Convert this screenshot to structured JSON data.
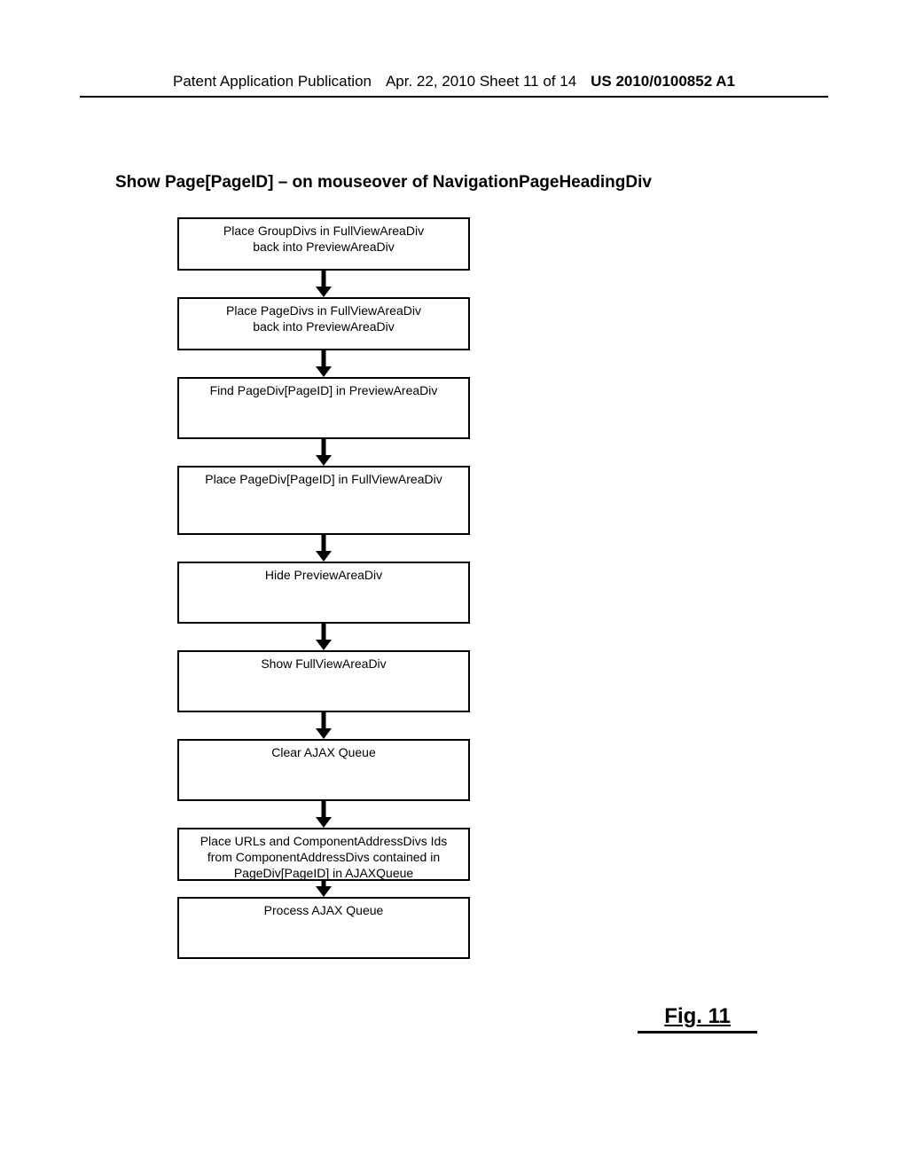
{
  "header": {
    "left": "Patent Application Publication",
    "mid": "Apr. 22, 2010  Sheet 11 of 14",
    "right": "US 2010/0100852 A1"
  },
  "title": "Show Page[PageID] – on mouseover of NavigationPageHeadingDiv",
  "steps": [
    {
      "lines": [
        "Place GroupDivs in FullViewAreaDiv",
        "back into PreviewAreaDiv"
      ],
      "h": "h1"
    },
    {
      "lines": [
        "Place PageDivs in FullViewAreaDiv",
        "back into PreviewAreaDiv"
      ],
      "h": "h1"
    },
    {
      "lines": [
        "Find PageDiv[PageID] in PreviewAreaDiv"
      ],
      "h": "h2"
    },
    {
      "lines": [
        "Place PageDiv[PageID] in FullViewAreaDiv"
      ],
      "h": "h3"
    },
    {
      "lines": [
        "Hide PreviewAreaDiv"
      ],
      "h": "h2"
    },
    {
      "lines": [
        "Show FullViewAreaDiv"
      ],
      "h": "h2"
    },
    {
      "lines": [
        "Clear AJAX Queue"
      ],
      "h": "h2"
    },
    {
      "lines": [
        "Place URLs and ComponentAddressDivs Ids",
        "from ComponentAddressDivs contained in",
        "PageDiv[PageID] in AJAXQueue"
      ],
      "h": "h1"
    },
    {
      "lines": [
        "Process AJAX Queue"
      ],
      "h": "h2"
    }
  ],
  "figure_label": "Fig. 11"
}
